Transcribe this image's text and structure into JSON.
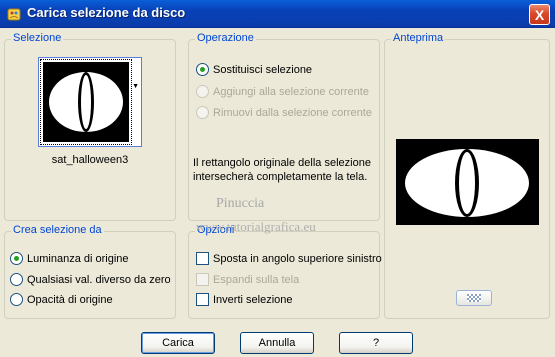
{
  "window": {
    "title": "Carica selezione da disco",
    "close_label": "X"
  },
  "selection_group": {
    "legend": "Selezione",
    "thumbnail_name": "sat_halloween3"
  },
  "operation_group": {
    "legend": "Operazione",
    "options": [
      {
        "label": "Sostituisci selezione",
        "selected": true,
        "enabled": true
      },
      {
        "label": "Aggiungi alla selezione corrente",
        "selected": false,
        "enabled": false
      },
      {
        "label": "Rimuovi dalla selezione corrente",
        "selected": false,
        "enabled": false
      }
    ],
    "info": "Il rettangolo originale della selezione intersecherà completamente la tela."
  },
  "preview_group": {
    "legend": "Anteprima"
  },
  "create_group": {
    "legend": "Crea selezione da",
    "options": [
      {
        "label": "Luminanza di origine",
        "selected": true
      },
      {
        "label": "Qualsiasi val. diverso da zero",
        "selected": false
      },
      {
        "label": "Opacità di origine",
        "selected": false
      }
    ]
  },
  "options_group": {
    "legend": "Opzioni",
    "checks": [
      {
        "label": "Sposta in angolo superiore sinistro",
        "checked": false,
        "enabled": true
      },
      {
        "label": "Espandi sulla tela",
        "checked": false,
        "enabled": false
      },
      {
        "label": "Inverti selezione",
        "checked": false,
        "enabled": true
      }
    ]
  },
  "watermark": {
    "line1": "Pinuccia",
    "line2": "www.tutorialgrafica.eu"
  },
  "buttons": {
    "load": "Carica",
    "cancel": "Annulla",
    "help": "?"
  }
}
